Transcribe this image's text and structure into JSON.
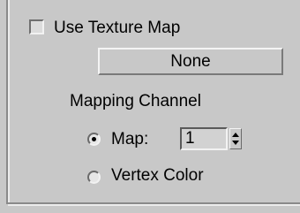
{
  "texture": {
    "use_texture_map_label": "Use Texture Map",
    "use_texture_map_checked": false,
    "map_button_label": "None"
  },
  "mapping_channel": {
    "title": "Mapping Channel",
    "options": [
      {
        "label": "Map:",
        "selected": true
      },
      {
        "label": "Vertex Color",
        "selected": false
      }
    ],
    "map_value": "1"
  }
}
